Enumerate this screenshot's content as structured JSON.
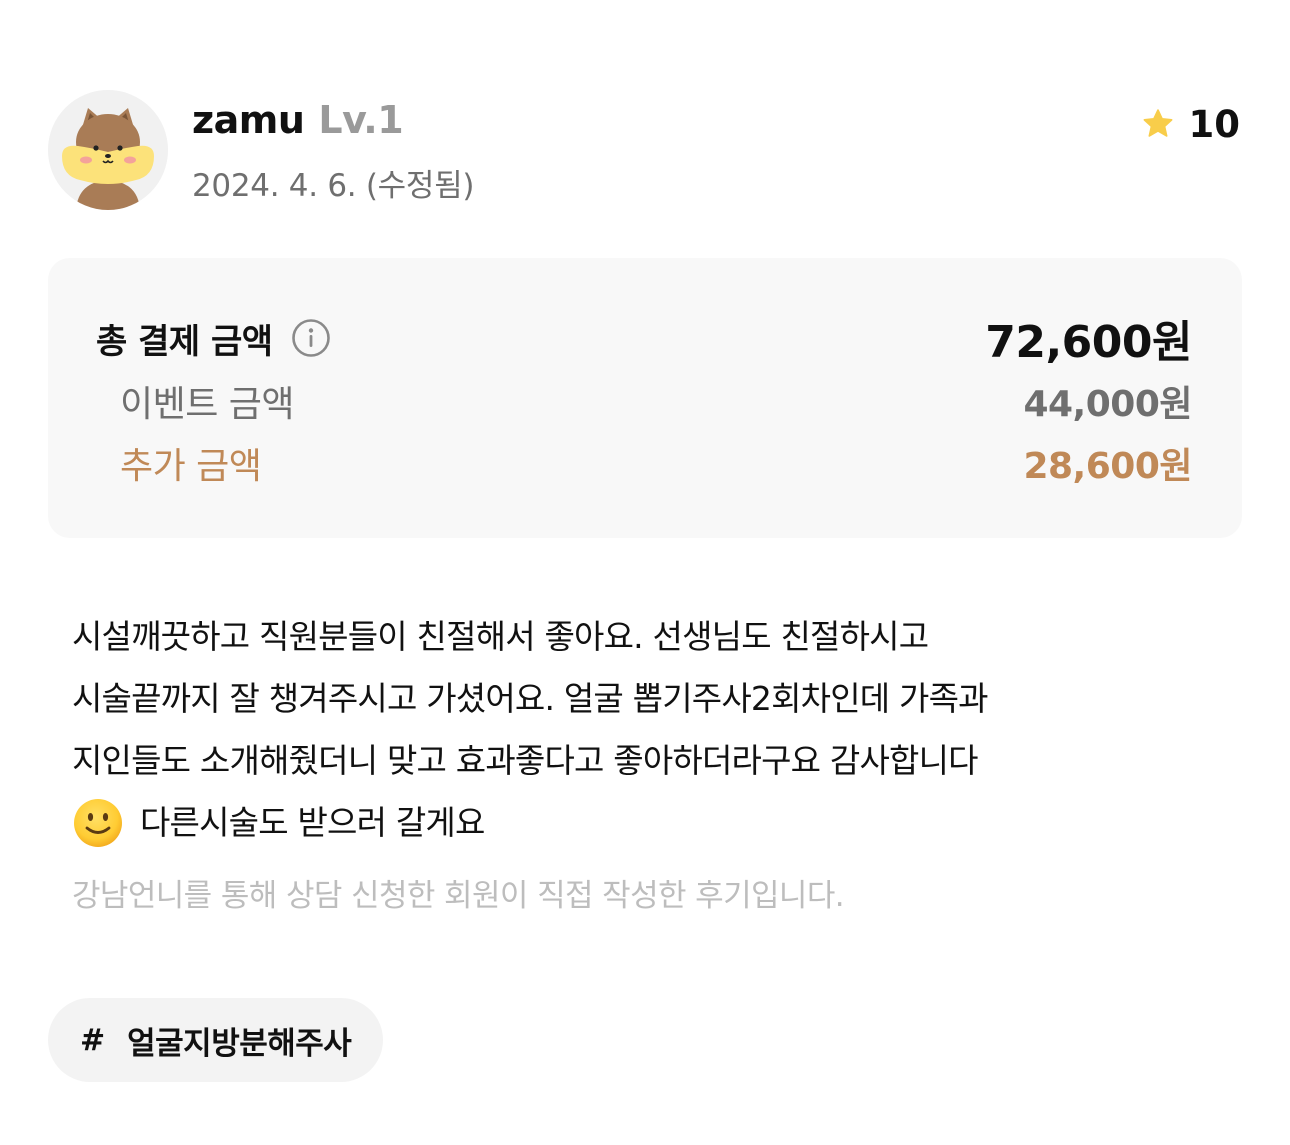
{
  "review": {
    "author": {
      "username": "zamu",
      "level": "Lv.1",
      "avatar_icon": "shiba-dog-avatar-icon"
    },
    "date": "2024. 4. 6. (수정됨)",
    "rating": {
      "value": "10",
      "icon": "star-icon",
      "icon_color": "#f8cd4a"
    },
    "price": {
      "total_label": "총 결제 금액",
      "total_value": "72,600원",
      "info_icon": "info-icon",
      "event_label": "이벤트 금액",
      "event_value": "44,000원",
      "extra_label": "추가 금액",
      "extra_value": "28,600원",
      "extra_color": "#c08957"
    },
    "body": {
      "line1": "시설깨끗하고 직원분들이 친절해서 좋아요. 선생님도 친절하시고",
      "line2": "시술끝까지 잘 챙겨주시고 가셨어요. 얼굴 뽑기주사2회차인데 가족과",
      "line3": "지인들도 소개해줬더니 맞고 효과좋다고 좋아하더라구요 감사합니다",
      "line4": "다른시술도 받으러 갈게요",
      "emoji": "slightly-smiling-face-emoji"
    },
    "disclaimer": "강남언니를 통해 상담 신청한 회원이 직접 작성한 후기입니다.",
    "tag": {
      "hash": "#",
      "label": "얼굴지방분해주사"
    }
  }
}
